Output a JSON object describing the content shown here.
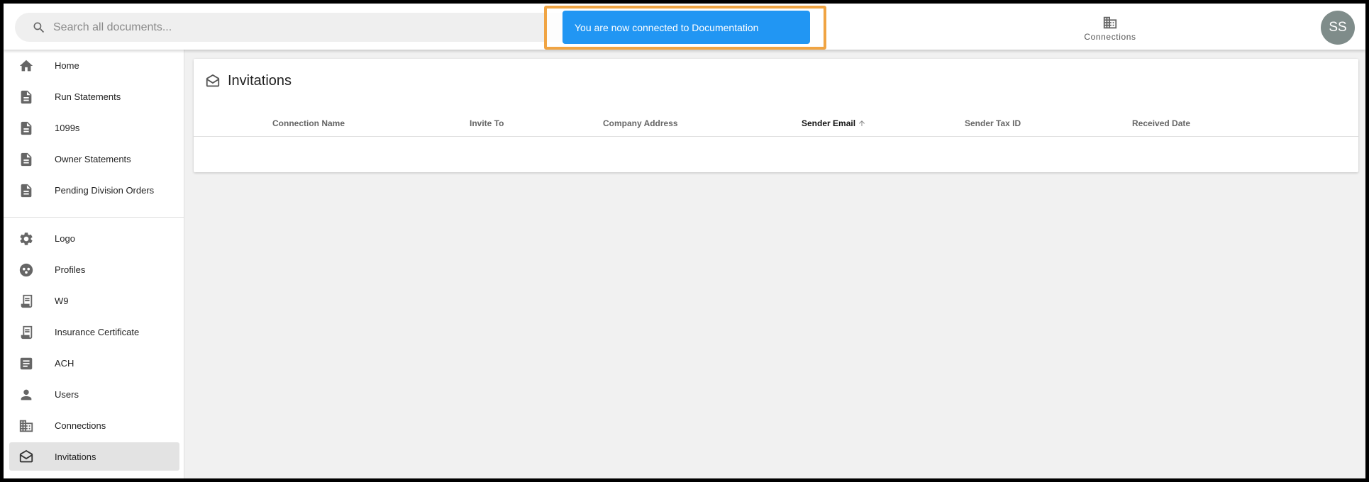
{
  "search": {
    "placeholder": "Search all documents..."
  },
  "toast": {
    "message": "You are now connected to Documentation"
  },
  "header": {
    "connections_label": "Connections",
    "avatar_initials": "SS"
  },
  "sidebar": {
    "items": [
      {
        "label": "Home",
        "icon": "home-icon"
      },
      {
        "label": "Run Statements",
        "icon": "document-icon"
      },
      {
        "label": "1099s",
        "icon": "document-icon"
      },
      {
        "label": "Owner Statements",
        "icon": "document-icon"
      },
      {
        "label": "Pending Division Orders",
        "icon": "document-icon"
      },
      {
        "label": "Logo",
        "icon": "gear-icon"
      },
      {
        "label": "Profiles",
        "icon": "profiles-icon"
      },
      {
        "label": "W9",
        "icon": "receipt-icon"
      },
      {
        "label": "Insurance Certificate",
        "icon": "receipt-icon"
      },
      {
        "label": "ACH",
        "icon": "article-icon"
      },
      {
        "label": "Users",
        "icon": "user-icon"
      },
      {
        "label": "Connections",
        "icon": "building-icon"
      },
      {
        "label": "Invitations",
        "icon": "envelope-open-icon",
        "active": true
      }
    ]
  },
  "main": {
    "title": "Invitations",
    "columns": [
      {
        "label": "Connection Name"
      },
      {
        "label": "Invite To"
      },
      {
        "label": "Company Address"
      },
      {
        "label": "Sender Email",
        "sorted": "ascending"
      },
      {
        "label": "Sender Tax ID"
      },
      {
        "label": "Received Date"
      }
    ],
    "rows": []
  },
  "colors": {
    "toast_bg": "#2196f3",
    "highlight_border": "#f0a443",
    "avatar_bg": "#7f8c8a",
    "active_nav_bg": "#e3e3e3"
  }
}
